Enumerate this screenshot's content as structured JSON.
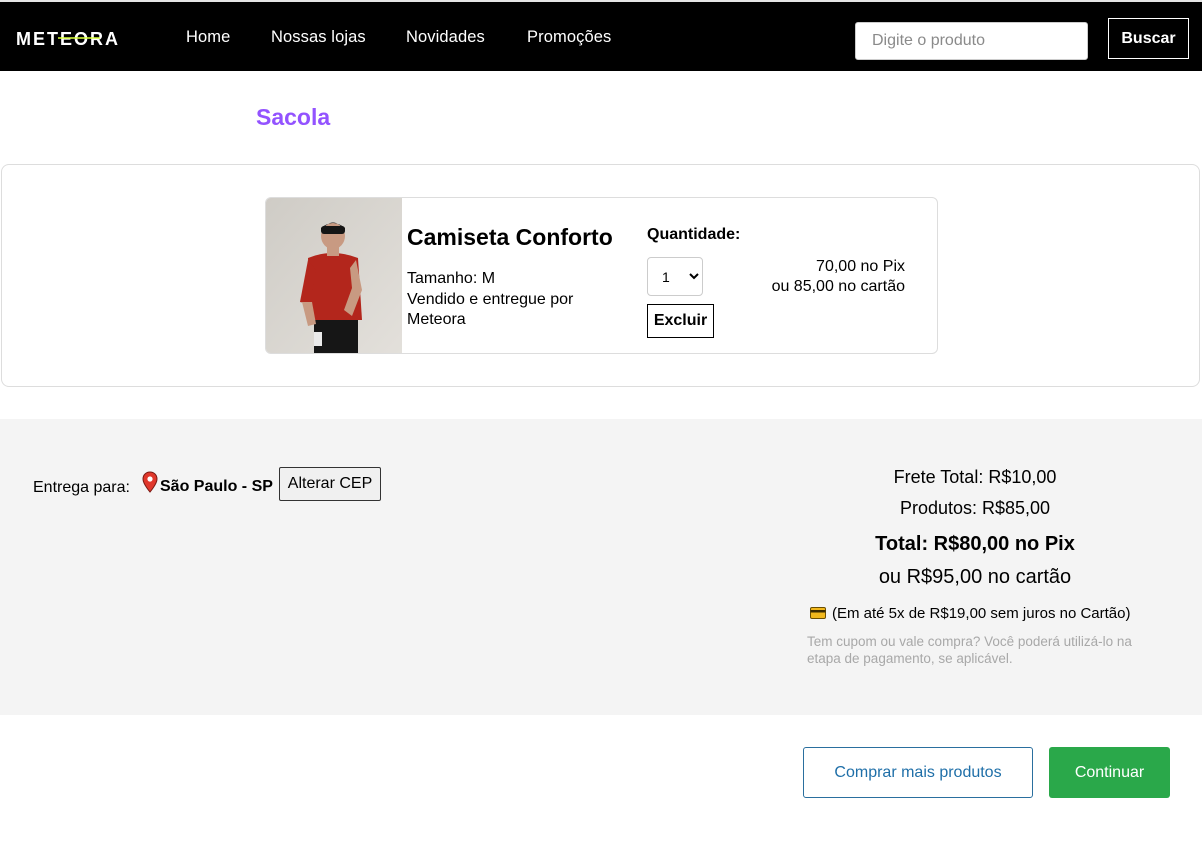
{
  "header": {
    "logo_text": "METEORA",
    "nav": [
      "Home",
      "Nossas lojas",
      "Novidades",
      "Promoções"
    ],
    "search_placeholder": "Digite o produto",
    "search_button": "Buscar"
  },
  "page": {
    "title": "Sacola"
  },
  "cart": {
    "items": [
      {
        "name": "Camiseta Conforto",
        "size": "Tamanho: M",
        "seller": "Vendido e entregue por Meteora",
        "quantity_label": "Quantidade:",
        "quantity": "1",
        "remove_label": "Excluir",
        "price_pix": "70,00 no Pix",
        "price_card": "ou 85,00 no cartão"
      }
    ]
  },
  "delivery": {
    "label": "Entrega para:",
    "city": "São Paulo - SP",
    "change_button": "Alterar CEP"
  },
  "summary": {
    "frete": "Frete Total: R$10,00",
    "produtos": "Produtos: R$85,00",
    "total_pix": "Total: R$80,00 no Pix",
    "total_card": "ou R$95,00 no cartão",
    "installment": "(Em até 5x de R$19,00 sem juros no Cartão)",
    "coupon_note": "Tem cupom ou vale compra? Você poderá utilizá-lo na etapa de pagamento, se aplicável."
  },
  "actions": {
    "more_products": "Comprar mais produtos",
    "continue": "Continuar"
  },
  "colors": {
    "accent_purple": "#9353ff",
    "continue_green": "#2aa84a",
    "link_blue": "#1f6fa8",
    "pin_red": "#e0372b"
  },
  "icons": [
    "map-pin-icon",
    "credit-card-icon"
  ]
}
